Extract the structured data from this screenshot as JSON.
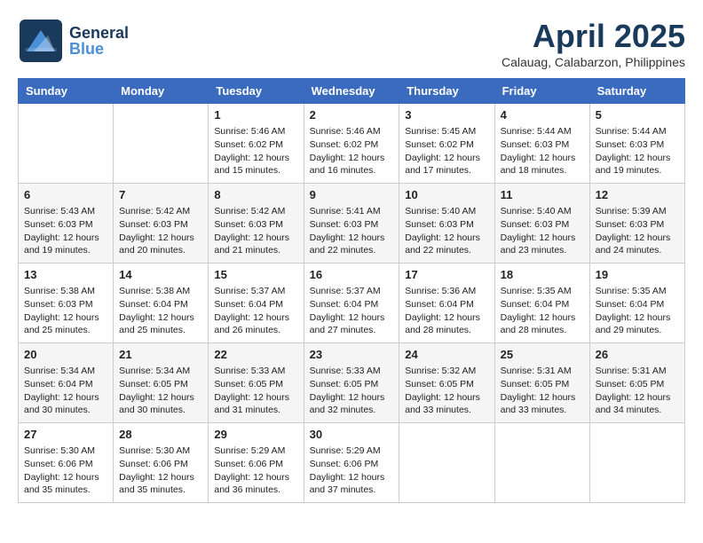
{
  "header": {
    "logo_general": "General",
    "logo_blue": "Blue",
    "month_year": "April 2025",
    "location": "Calauag, Calabarzon, Philippines"
  },
  "weekdays": [
    "Sunday",
    "Monday",
    "Tuesday",
    "Wednesday",
    "Thursday",
    "Friday",
    "Saturday"
  ],
  "weeks": [
    [
      {
        "day": "",
        "sunrise": "",
        "sunset": "",
        "daylight": ""
      },
      {
        "day": "",
        "sunrise": "",
        "sunset": "",
        "daylight": ""
      },
      {
        "day": "1",
        "sunrise": "Sunrise: 5:46 AM",
        "sunset": "Sunset: 6:02 PM",
        "daylight": "Daylight: 12 hours and 15 minutes."
      },
      {
        "day": "2",
        "sunrise": "Sunrise: 5:46 AM",
        "sunset": "Sunset: 6:02 PM",
        "daylight": "Daylight: 12 hours and 16 minutes."
      },
      {
        "day": "3",
        "sunrise": "Sunrise: 5:45 AM",
        "sunset": "Sunset: 6:02 PM",
        "daylight": "Daylight: 12 hours and 17 minutes."
      },
      {
        "day": "4",
        "sunrise": "Sunrise: 5:44 AM",
        "sunset": "Sunset: 6:03 PM",
        "daylight": "Daylight: 12 hours and 18 minutes."
      },
      {
        "day": "5",
        "sunrise": "Sunrise: 5:44 AM",
        "sunset": "Sunset: 6:03 PM",
        "daylight": "Daylight: 12 hours and 19 minutes."
      }
    ],
    [
      {
        "day": "6",
        "sunrise": "Sunrise: 5:43 AM",
        "sunset": "Sunset: 6:03 PM",
        "daylight": "Daylight: 12 hours and 19 minutes."
      },
      {
        "day": "7",
        "sunrise": "Sunrise: 5:42 AM",
        "sunset": "Sunset: 6:03 PM",
        "daylight": "Daylight: 12 hours and 20 minutes."
      },
      {
        "day": "8",
        "sunrise": "Sunrise: 5:42 AM",
        "sunset": "Sunset: 6:03 PM",
        "daylight": "Daylight: 12 hours and 21 minutes."
      },
      {
        "day": "9",
        "sunrise": "Sunrise: 5:41 AM",
        "sunset": "Sunset: 6:03 PM",
        "daylight": "Daylight: 12 hours and 22 minutes."
      },
      {
        "day": "10",
        "sunrise": "Sunrise: 5:40 AM",
        "sunset": "Sunset: 6:03 PM",
        "daylight": "Daylight: 12 hours and 22 minutes."
      },
      {
        "day": "11",
        "sunrise": "Sunrise: 5:40 AM",
        "sunset": "Sunset: 6:03 PM",
        "daylight": "Daylight: 12 hours and 23 minutes."
      },
      {
        "day": "12",
        "sunrise": "Sunrise: 5:39 AM",
        "sunset": "Sunset: 6:03 PM",
        "daylight": "Daylight: 12 hours and 24 minutes."
      }
    ],
    [
      {
        "day": "13",
        "sunrise": "Sunrise: 5:38 AM",
        "sunset": "Sunset: 6:03 PM",
        "daylight": "Daylight: 12 hours and 25 minutes."
      },
      {
        "day": "14",
        "sunrise": "Sunrise: 5:38 AM",
        "sunset": "Sunset: 6:04 PM",
        "daylight": "Daylight: 12 hours and 25 minutes."
      },
      {
        "day": "15",
        "sunrise": "Sunrise: 5:37 AM",
        "sunset": "Sunset: 6:04 PM",
        "daylight": "Daylight: 12 hours and 26 minutes."
      },
      {
        "day": "16",
        "sunrise": "Sunrise: 5:37 AM",
        "sunset": "Sunset: 6:04 PM",
        "daylight": "Daylight: 12 hours and 27 minutes."
      },
      {
        "day": "17",
        "sunrise": "Sunrise: 5:36 AM",
        "sunset": "Sunset: 6:04 PM",
        "daylight": "Daylight: 12 hours and 28 minutes."
      },
      {
        "day": "18",
        "sunrise": "Sunrise: 5:35 AM",
        "sunset": "Sunset: 6:04 PM",
        "daylight": "Daylight: 12 hours and 28 minutes."
      },
      {
        "day": "19",
        "sunrise": "Sunrise: 5:35 AM",
        "sunset": "Sunset: 6:04 PM",
        "daylight": "Daylight: 12 hours and 29 minutes."
      }
    ],
    [
      {
        "day": "20",
        "sunrise": "Sunrise: 5:34 AM",
        "sunset": "Sunset: 6:04 PM",
        "daylight": "Daylight: 12 hours and 30 minutes."
      },
      {
        "day": "21",
        "sunrise": "Sunrise: 5:34 AM",
        "sunset": "Sunset: 6:05 PM",
        "daylight": "Daylight: 12 hours and 30 minutes."
      },
      {
        "day": "22",
        "sunrise": "Sunrise: 5:33 AM",
        "sunset": "Sunset: 6:05 PM",
        "daylight": "Daylight: 12 hours and 31 minutes."
      },
      {
        "day": "23",
        "sunrise": "Sunrise: 5:33 AM",
        "sunset": "Sunset: 6:05 PM",
        "daylight": "Daylight: 12 hours and 32 minutes."
      },
      {
        "day": "24",
        "sunrise": "Sunrise: 5:32 AM",
        "sunset": "Sunset: 6:05 PM",
        "daylight": "Daylight: 12 hours and 33 minutes."
      },
      {
        "day": "25",
        "sunrise": "Sunrise: 5:31 AM",
        "sunset": "Sunset: 6:05 PM",
        "daylight": "Daylight: 12 hours and 33 minutes."
      },
      {
        "day": "26",
        "sunrise": "Sunrise: 5:31 AM",
        "sunset": "Sunset: 6:05 PM",
        "daylight": "Daylight: 12 hours and 34 minutes."
      }
    ],
    [
      {
        "day": "27",
        "sunrise": "Sunrise: 5:30 AM",
        "sunset": "Sunset: 6:06 PM",
        "daylight": "Daylight: 12 hours and 35 minutes."
      },
      {
        "day": "28",
        "sunrise": "Sunrise: 5:30 AM",
        "sunset": "Sunset: 6:06 PM",
        "daylight": "Daylight: 12 hours and 35 minutes."
      },
      {
        "day": "29",
        "sunrise": "Sunrise: 5:29 AM",
        "sunset": "Sunset: 6:06 PM",
        "daylight": "Daylight: 12 hours and 36 minutes."
      },
      {
        "day": "30",
        "sunrise": "Sunrise: 5:29 AM",
        "sunset": "Sunset: 6:06 PM",
        "daylight": "Daylight: 12 hours and 37 minutes."
      },
      {
        "day": "",
        "sunrise": "",
        "sunset": "",
        "daylight": ""
      },
      {
        "day": "",
        "sunrise": "",
        "sunset": "",
        "daylight": ""
      },
      {
        "day": "",
        "sunrise": "",
        "sunset": "",
        "daylight": ""
      }
    ]
  ]
}
